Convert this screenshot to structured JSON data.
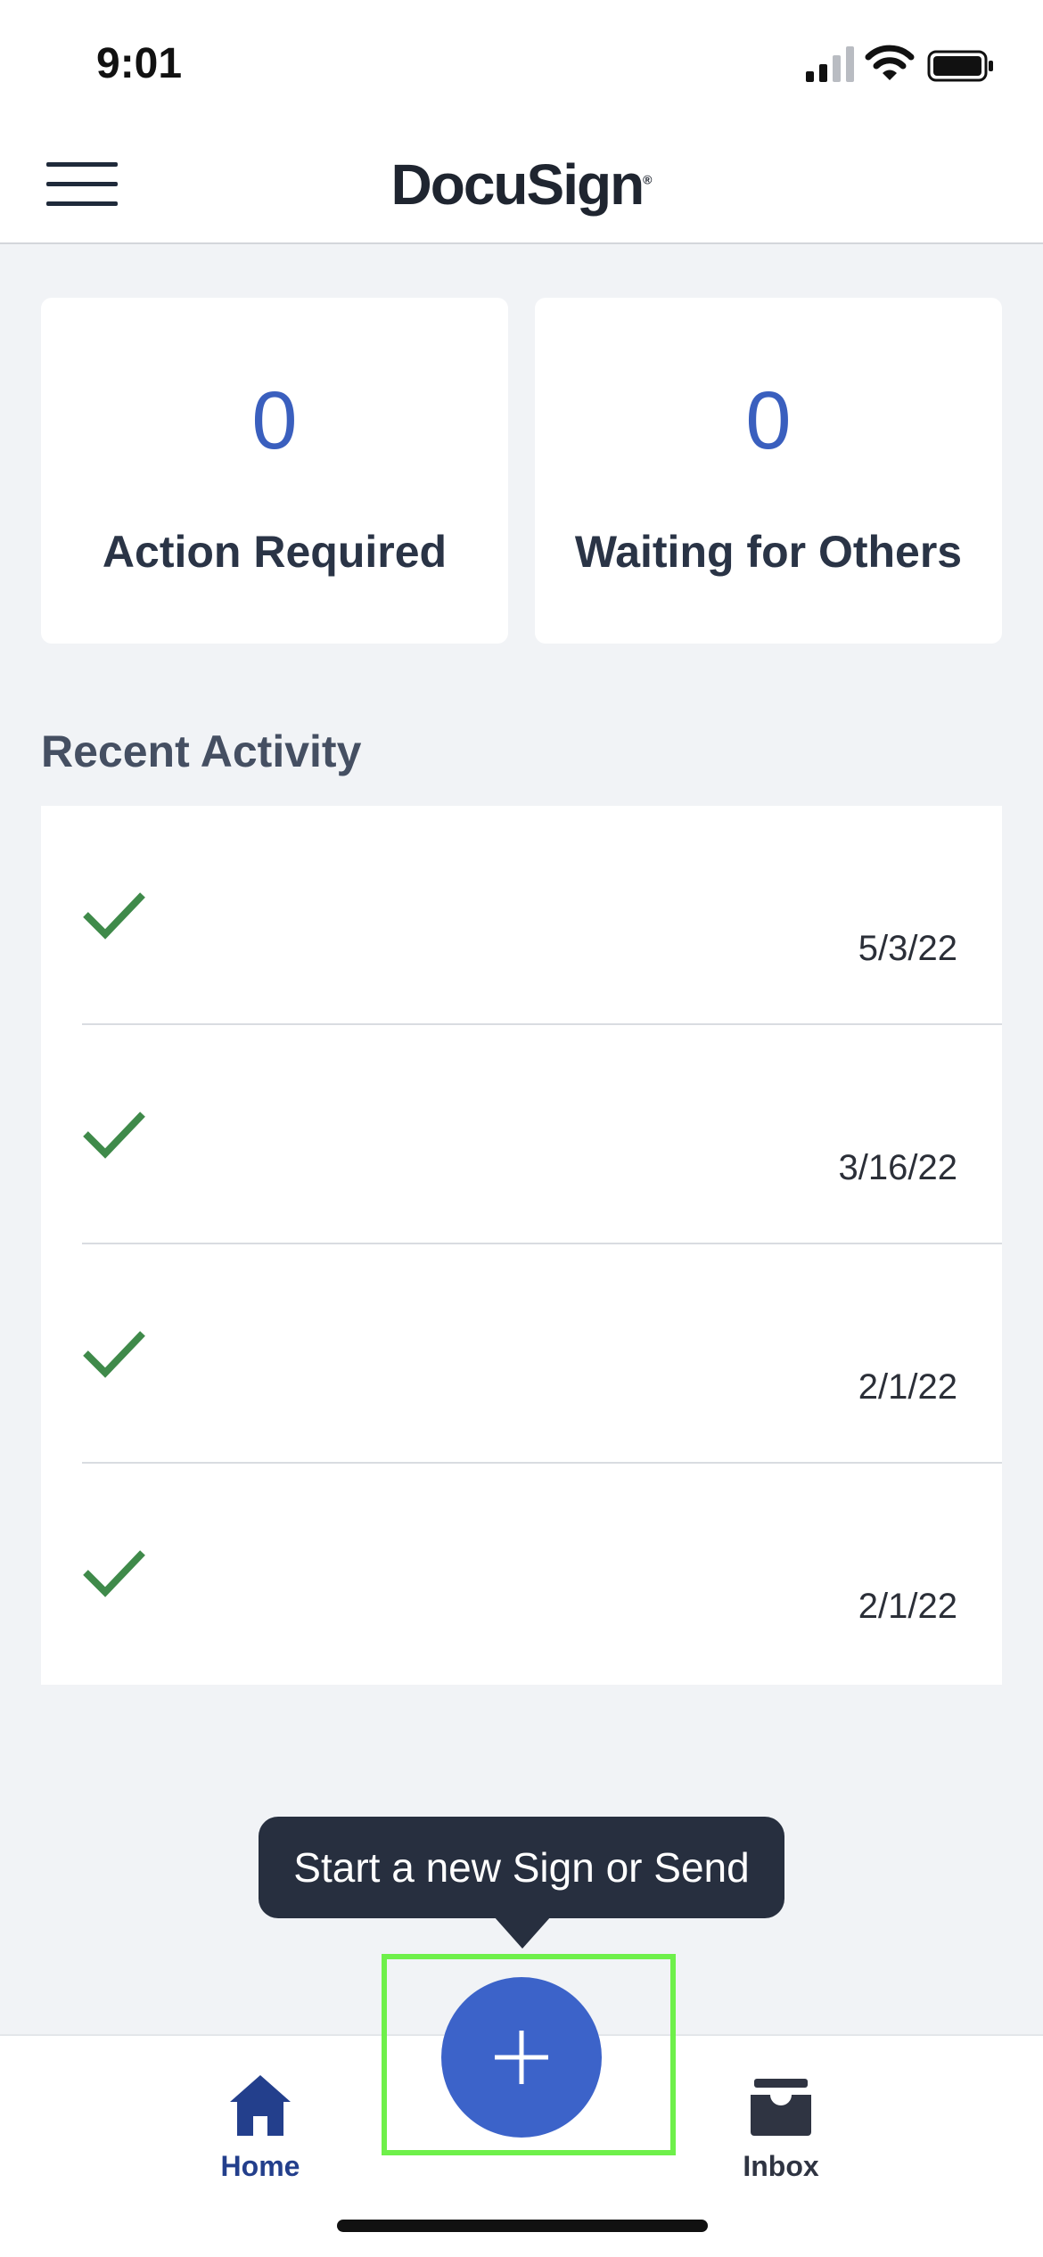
{
  "status_bar": {
    "time": "9:01"
  },
  "header": {
    "brand": "DocuSign",
    "brand_mark": "®"
  },
  "stats": [
    {
      "count": "0",
      "label": "Action Required"
    },
    {
      "count": "0",
      "label": "Waiting for Others"
    }
  ],
  "recent_activity": {
    "title": "Recent Activity",
    "items": [
      {
        "date": "5/3/22",
        "status_icon": "check-icon"
      },
      {
        "date": "3/16/22",
        "status_icon": "check-icon"
      },
      {
        "date": "2/1/22",
        "status_icon": "check-icon"
      },
      {
        "date": "2/1/22",
        "status_icon": "check-icon"
      }
    ]
  },
  "tooltip": {
    "text": "Start a new Sign or Send"
  },
  "tab_bar": {
    "home_label": "Home",
    "inbox_label": "Inbox"
  },
  "colors": {
    "accent": "#3c63c9",
    "check_green": "#3f8a4a",
    "highlight": "#6ef04a",
    "tooltip_bg": "#272f3f"
  }
}
